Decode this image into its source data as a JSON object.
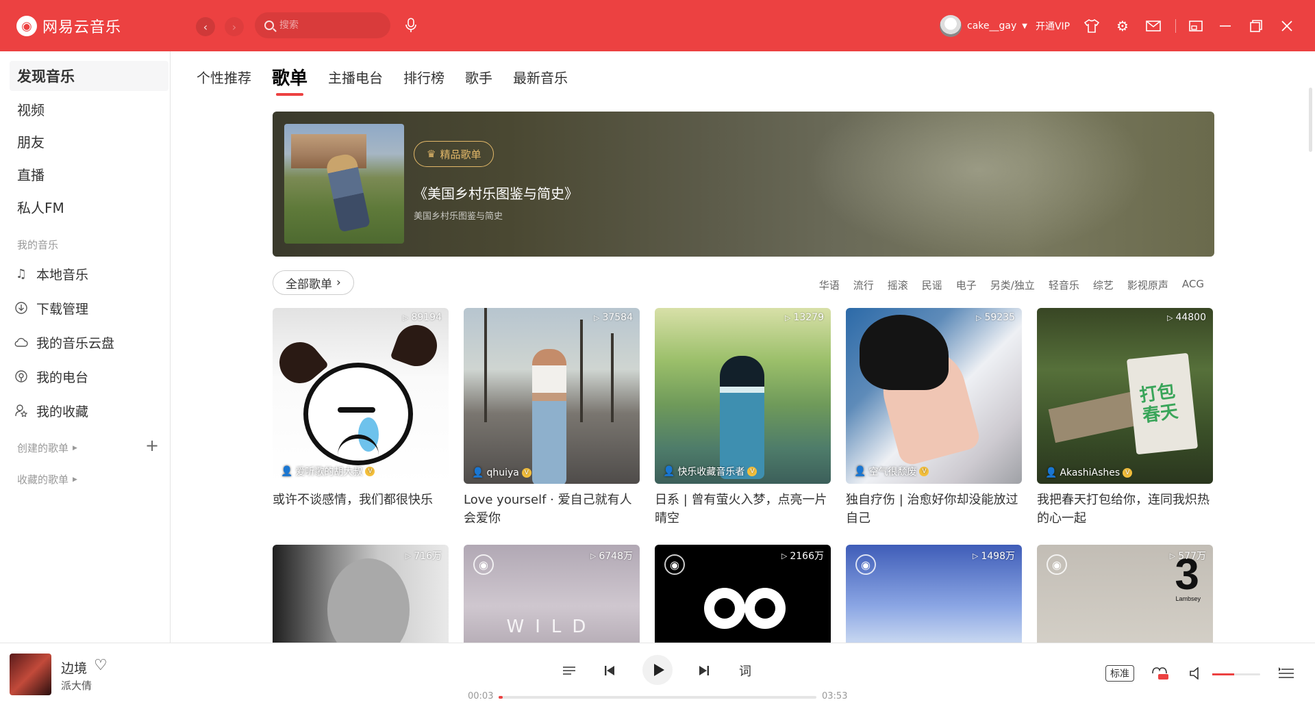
{
  "app": {
    "name": "网易云音乐",
    "search_placeholder": "搜索",
    "username": "cake__gay",
    "vip_label": "开通VIP"
  },
  "sidebar": {
    "main_items": [
      {
        "label": "发现音乐"
      },
      {
        "label": "视频"
      },
      {
        "label": "朋友"
      },
      {
        "label": "直播"
      },
      {
        "label": "私人FM"
      }
    ],
    "my_music_label": "我的音乐",
    "my_items": [
      {
        "label": "本地音乐",
        "icon": "music-note-icon"
      },
      {
        "label": "下载管理",
        "icon": "download-icon"
      },
      {
        "label": "我的音乐云盘",
        "icon": "cloud-icon"
      },
      {
        "label": "我的电台",
        "icon": "podcast-icon"
      },
      {
        "label": "我的收藏",
        "icon": "collection-icon"
      }
    ],
    "created_label": "创建的歌单",
    "collected_label": "收藏的歌单"
  },
  "tabs": [
    {
      "label": "个性推荐"
    },
    {
      "label": "歌单",
      "active": true
    },
    {
      "label": "主播电台"
    },
    {
      "label": "排行榜"
    },
    {
      "label": "歌手"
    },
    {
      "label": "最新音乐"
    }
  ],
  "banner": {
    "badge": "精品歌单",
    "title": "《美国乡村乐图鉴与简史》",
    "subtitle": "美国乡村乐图鉴与简史"
  },
  "filter": {
    "all_button": "全部歌单",
    "genres": [
      "华语",
      "流行",
      "摇滚",
      "民谣",
      "电子",
      "另类/独立",
      "轻音乐",
      "综艺",
      "影视原声",
      "ACG"
    ]
  },
  "playlists": [
    {
      "plays": "89194",
      "creator": "爱听歌的胡大叔",
      "title": "或许不谈感情，我们都很快乐"
    },
    {
      "plays": "37584",
      "creator": "qhuiya",
      "title": "Love yourself · 爱自己就有人会爱你"
    },
    {
      "plays": "13279",
      "creator": "快乐收藏音乐者",
      "title": "日系 | 曾有萤火入梦，点亮一片晴空"
    },
    {
      "plays": "59235",
      "creator": "空气很颓废",
      "title": "独自疗伤 | 治愈好你却没能放过自己"
    },
    {
      "plays": "44800",
      "creator": "AkashiAshes",
      "title": "我把春天打包给你，连同我炽热的心一起"
    },
    {
      "plays": "716万",
      "creator": "",
      "title": ""
    },
    {
      "plays": "6748万",
      "creator": "",
      "title": ""
    },
    {
      "plays": "2166万",
      "creator": "",
      "title": ""
    },
    {
      "plays": "1498万",
      "creator": "",
      "title": ""
    },
    {
      "plays": "577万",
      "creator": "",
      "title": ""
    }
  ],
  "cover_text": {
    "spring_line1": "打包",
    "spring_line2": "春天",
    "wild": "WILD",
    "three": "3",
    "lambsey": "Lambsey"
  },
  "player": {
    "song": "边境",
    "artist": "派大倩",
    "current_time": "00:03",
    "total_time": "03:53",
    "progress": 0.013,
    "lyrics_label": "词",
    "quality": "标准",
    "volume": 0.45
  }
}
